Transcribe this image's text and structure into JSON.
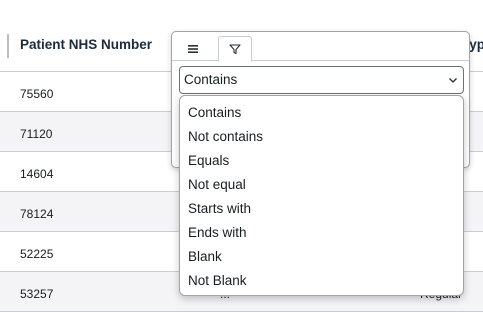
{
  "grid": {
    "columns": [
      "Patient NHS Number",
      "",
      "Typ"
    ],
    "rows": [
      {
        "nhs": "75560",
        "c2": "",
        "c3": ""
      },
      {
        "nhs": "71120",
        "c2": "",
        "c3": ""
      },
      {
        "nhs": "14604",
        "c2": "",
        "c3": ""
      },
      {
        "nhs": "78124",
        "c2": "",
        "c3": ""
      },
      {
        "nhs": "52225",
        "c2": "",
        "c3": ""
      },
      {
        "nhs": "53257",
        "c2": "...",
        "c3": "Regular"
      }
    ]
  },
  "filter_popup": {
    "tabs": [
      {
        "name": "menu-icon",
        "active": false
      },
      {
        "name": "filter-icon",
        "active": true
      }
    ],
    "selected_operator": "Contains",
    "options": [
      "Contains",
      "Not contains",
      "Equals",
      "Not equal",
      "Starts with",
      "Ends with",
      "Blank",
      "Not Blank"
    ]
  },
  "colors": {
    "row_alt": "#f4f4f6",
    "border": "#c9ccd6",
    "text": "#181d1f"
  }
}
